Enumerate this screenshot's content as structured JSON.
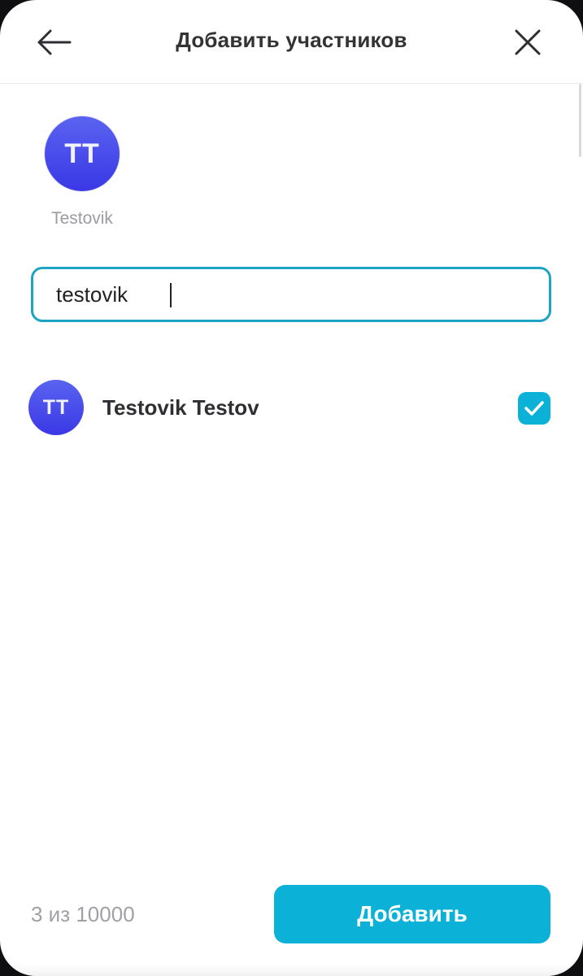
{
  "header": {
    "title": "Добавить участников",
    "back_icon": "arrow-left-icon",
    "close_icon": "close-icon"
  },
  "selected": [
    {
      "initials": "TT",
      "name": "Testovik"
    }
  ],
  "search": {
    "value": "testovik",
    "placeholder": ""
  },
  "results": [
    {
      "initials": "TT",
      "name": "Testovik Testov",
      "checked": true
    }
  ],
  "footer": {
    "counter": "3 из 10000",
    "add_label": "Добавить"
  },
  "colors": {
    "accent": "#0bb1d6",
    "avatar_gradient_top": "#5a63f0",
    "avatar_gradient_bottom": "#3a38e6",
    "focus_border": "#1fa3c2",
    "muted_text": "#9a9aa0"
  }
}
